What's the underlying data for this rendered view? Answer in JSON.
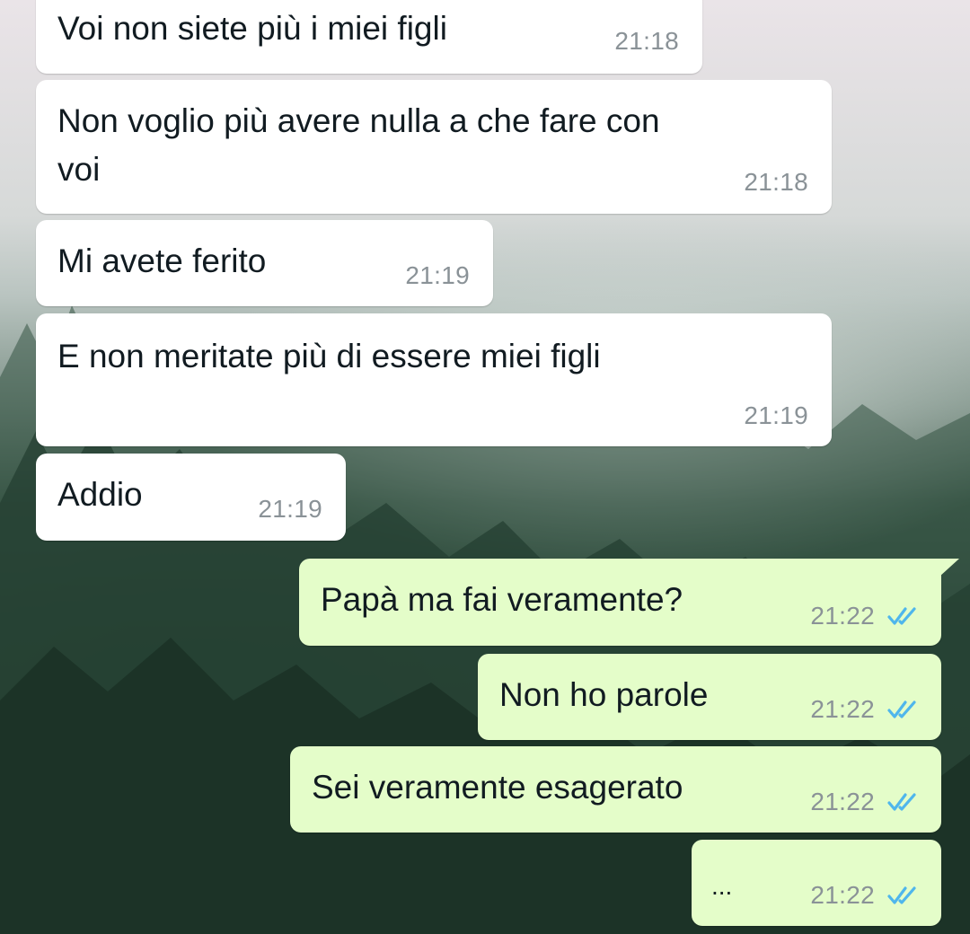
{
  "colors": {
    "incoming_bubble": "#ffffff",
    "outgoing_bubble": "#e4fdc9",
    "timestamp": "#8a9297",
    "read_ticks": "#4fb6ec"
  },
  "messages": [
    {
      "direction": "in",
      "text": "Voi non siete più i miei figli",
      "time": "21:18"
    },
    {
      "direction": "in",
      "text_line1": "Non voglio più avere nulla a che fare con",
      "text_line2": "voi",
      "time": "21:18"
    },
    {
      "direction": "in",
      "text": "Mi avete ferito",
      "time": "21:19"
    },
    {
      "direction": "in",
      "text": "E non meritate più di essere miei figli",
      "time": "21:19"
    },
    {
      "direction": "in",
      "text": "Addio",
      "time": "21:19"
    },
    {
      "direction": "out",
      "text": "Papà ma fai veramente?",
      "time": "21:22",
      "status_icon": "double-check-read-icon"
    },
    {
      "direction": "out",
      "text": "Non ho parole",
      "time": "21:22",
      "status_icon": "double-check-read-icon"
    },
    {
      "direction": "out",
      "text": "Sei veramente esagerato",
      "time": "21:22",
      "status_icon": "double-check-read-icon"
    },
    {
      "direction": "out",
      "text": "...",
      "time": "21:22",
      "status_icon": "double-check-read-icon"
    }
  ]
}
